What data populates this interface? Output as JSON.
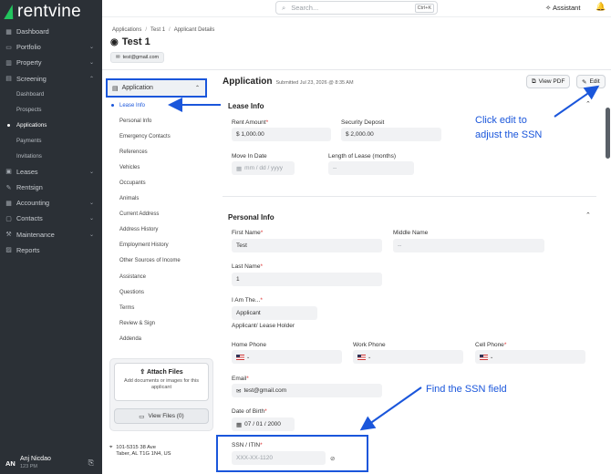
{
  "brand": {
    "name": "rentvine"
  },
  "sidebar": {
    "items": [
      {
        "label": "Dashboard",
        "icon": "grid-icon"
      },
      {
        "label": "Portfolio",
        "icon": "folder-icon",
        "chevron": true
      },
      {
        "label": "Property",
        "icon": "building-icon",
        "chevron": true
      },
      {
        "label": "Screening",
        "icon": "screening-icon",
        "chevron": true,
        "expanded": true
      }
    ],
    "screening_sub": [
      "Dashboard",
      "Prospects",
      "Applications",
      "Payments",
      "Invitations"
    ],
    "items2": [
      {
        "label": "Leases",
        "icon": "lease-icon",
        "chevron": true
      },
      {
        "label": "Rentsign",
        "icon": "sign-icon"
      },
      {
        "label": "Accounting",
        "icon": "accounting-icon",
        "chevron": true
      },
      {
        "label": "Contacts",
        "icon": "contacts-icon",
        "chevron": true
      },
      {
        "label": "Maintenance",
        "icon": "wrench-icon",
        "chevron": true
      },
      {
        "label": "Reports",
        "icon": "chart-icon"
      }
    ],
    "user": {
      "initials": "AN",
      "name": "Anj Nicdao",
      "id": "123 PM"
    }
  },
  "topbar": {
    "search_placeholder": "Search...",
    "shortcut": "Ctrl+K",
    "assistant": "Assistant"
  },
  "breadcrumb": [
    "Applications",
    "Test 1",
    "Applicant Details"
  ],
  "title": "Test 1",
  "email_chip": "test@gmail.com",
  "subnav": {
    "head": "Application",
    "items": [
      "Lease Info",
      "Personal Info",
      "Emergency Contacts",
      "References",
      "Vehicles",
      "Occupants",
      "Animals",
      "Current Address",
      "Address History",
      "Employment History",
      "Other Sources of Income",
      "Assistance",
      "Questions",
      "Terms",
      "Review & Sign",
      "Addenda"
    ]
  },
  "attach": {
    "title": "Attach Files",
    "desc": "Add documents or images for this applicant",
    "view": "View Files (0)"
  },
  "address": {
    "line1": "101-5315 38 Ave",
    "line2": "Taber, AL T1G 1N4, US"
  },
  "application": {
    "title": "Application",
    "submitted": "Submitted Jul 23, 2026 @ 8:35 AM",
    "view_pdf": "View PDF",
    "edit": "Edit",
    "lease_info": {
      "title": "Lease Info",
      "rent_label": "Rent Amount",
      "rent": "$ 1,000.00",
      "deposit_label": "Security Deposit",
      "deposit": "$ 2,000.00",
      "move_label": "Move In Date",
      "move_placeholder": "mm / dd / yyyy",
      "length_label": "Length of Lease (months)",
      "length": "--"
    },
    "personal": {
      "title": "Personal Info",
      "first_label": "First Name",
      "first": "Test",
      "middle_label": "Middle Name",
      "middle": "--",
      "last_label": "Last Name",
      "last": "1",
      "iam_label": "I Am The...",
      "iam": "Applicant",
      "iam_desc": "Applicant/ Lease Holder",
      "home_label": "Home Phone",
      "work_label": "Work Phone",
      "cell_label": "Cell Phone",
      "email_label": "Email",
      "email": "test@gmail.com",
      "dob_label": "Date of Birth",
      "dob": "07 / 01 / 2000",
      "ssn_label": "SSN / ITIN",
      "ssn": "XXX-XX-1120"
    }
  },
  "annotations": {
    "edit_note": "Click edit to adjust the SSN",
    "ssn_note": "Find the SSN field"
  },
  "colors": {
    "accent": "#1a56db",
    "sidebar": "#2b3036",
    "brand_green": "#22c55e"
  }
}
